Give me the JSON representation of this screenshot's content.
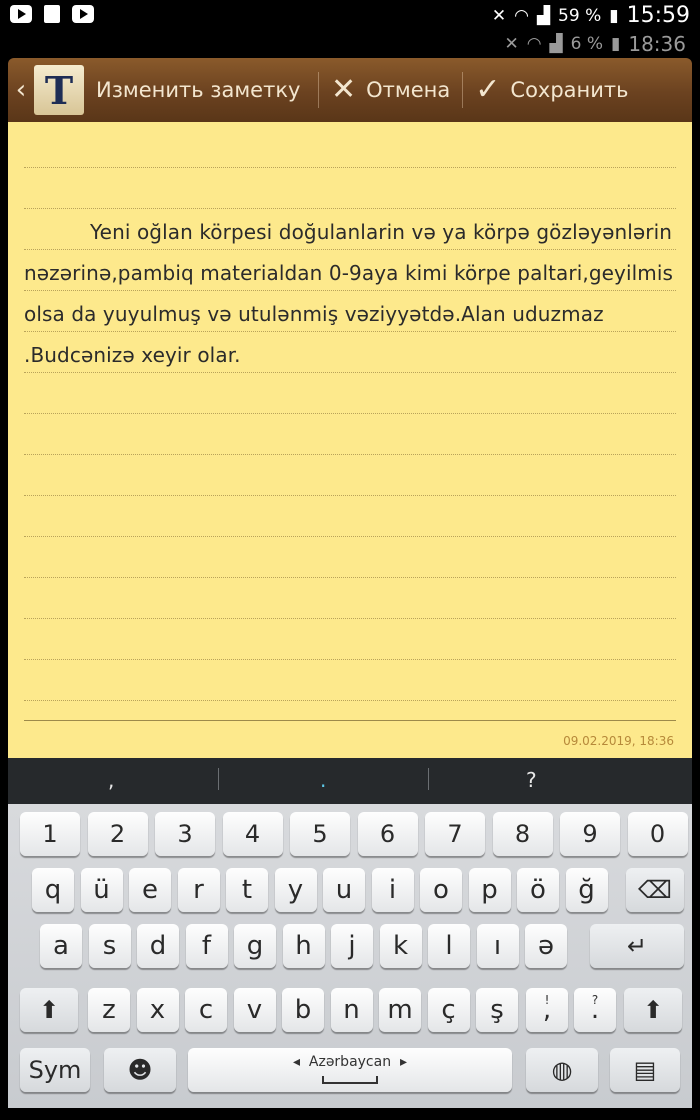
{
  "status": {
    "battery": "59 %",
    "time": "15:59",
    "ghost_battery": "6 %",
    "ghost_time": "18:36",
    "icons": [
      "youtube-icon",
      "settings-icon",
      "youtube-icon",
      "mute-icon",
      "wifi-icon",
      "signal-icon"
    ]
  },
  "actionbar": {
    "app_icon_letter": "T",
    "title": "Изменить заметку",
    "cancel_label": "Отмена",
    "save_label": "Сохранить"
  },
  "note": {
    "text": "Yeni oğlan körpesi doğulanlarin və ya körpə gözləyənlərin nəzərinə,pambiq materialdan 0-9aya kimi körpe paltari,geyilmis olsa da yuyulmuş və utulənmiş vəziyyətdə.Alan uduzmaz .Budcənizə xeyir olar.",
    "timestamp": "09.02.2019,  18:36"
  },
  "suggestions": [
    ",",
    ".",
    "?"
  ],
  "keyboard": {
    "row_numbers": [
      "1",
      "2",
      "3",
      "4",
      "5",
      "6",
      "7",
      "8",
      "9",
      "0"
    ],
    "row1": [
      "q",
      "ü",
      "e",
      "r",
      "t",
      "y",
      "u",
      "i",
      "o",
      "p",
      "ö",
      "ğ"
    ],
    "row2": [
      "a",
      "s",
      "d",
      "f",
      "g",
      "h",
      "j",
      "k",
      "l",
      "ı",
      "ə"
    ],
    "row3": [
      "z",
      "x",
      "c",
      "v",
      "b",
      "n",
      "m",
      "ç",
      "ş"
    ],
    "row3_punct": [
      "!",
      "?"
    ],
    "sym_label": "Sym",
    "language": "Azərbaycan",
    "colors": {
      "paper": "#fde98c",
      "actionbar": "#6b4220"
    }
  }
}
